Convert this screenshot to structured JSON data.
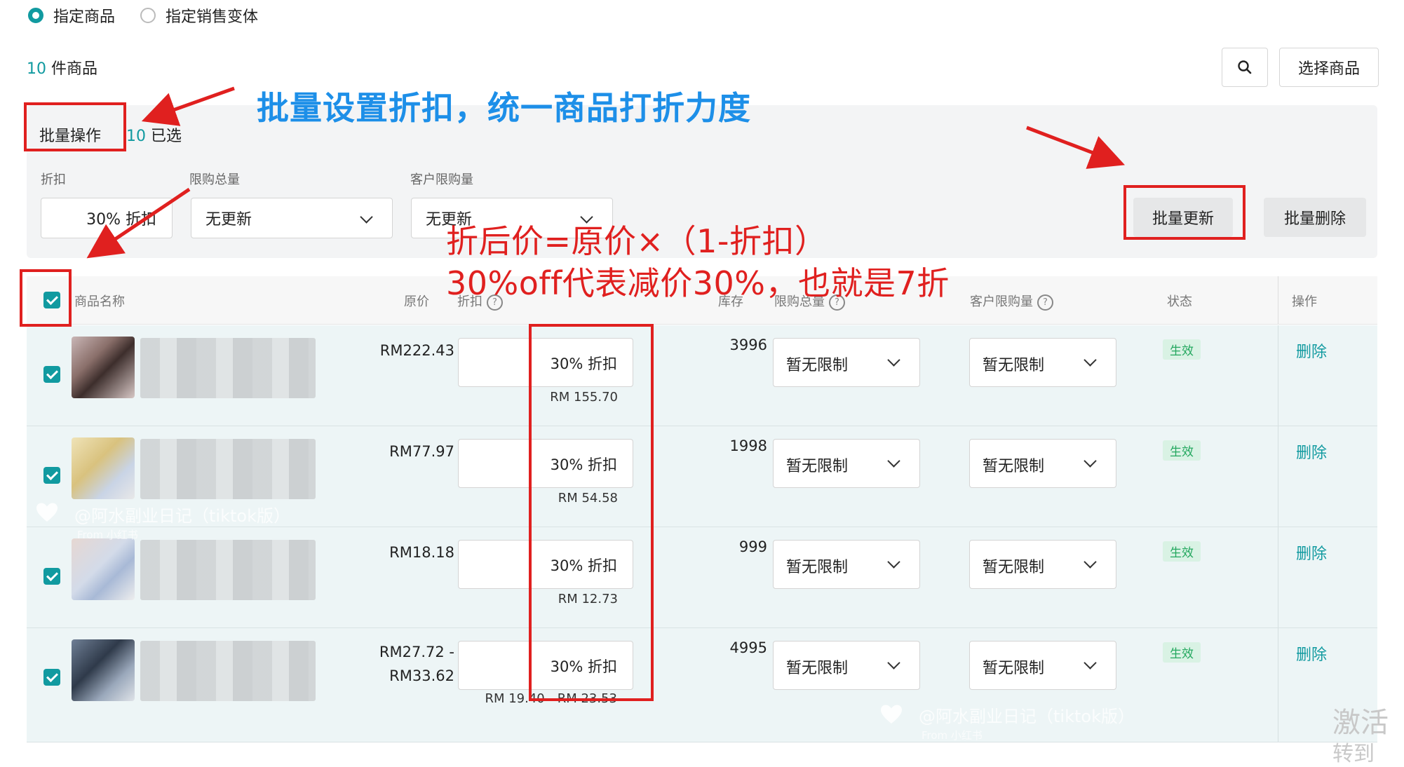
{
  "scope": {
    "option_specified_products": "指定商品",
    "option_specified_variants": "指定销售变体"
  },
  "product_count": {
    "num": "10",
    "label": "件商品"
  },
  "toolbar": {
    "search_icon": "search-icon",
    "select_products": "选择商品"
  },
  "batch": {
    "tab_label": "批量操作",
    "selected_num": "10",
    "selected_label": "已选",
    "discount_label": "折扣",
    "discount_value": "30% 折扣",
    "total_limit_label": "限购总量",
    "total_limit_value": "无更新",
    "customer_limit_label": "客户限购量",
    "customer_limit_value": "无更新",
    "update_button": "批量更新",
    "delete_button": "批量删除"
  },
  "annotations": {
    "batch_note": "批量设置折扣，统一商品打折力度",
    "formula": "折后价=原价×（1-折扣）",
    "explain": "30%off代表减价30%，也就是7折",
    "color_red": "#e0201f",
    "color_blue": "#1d8fe8"
  },
  "table": {
    "headers": {
      "name": "商品名称",
      "price": "原价",
      "discount": "折扣",
      "stock": "库存",
      "total_limit": "限购总量",
      "customer_limit": "客户限购量",
      "status": "状态",
      "action": "操作"
    },
    "rows": [
      {
        "price": "RM222.43",
        "discount": "30% 折扣",
        "after": "RM 155.70",
        "stock": "3996",
        "total_limit": "暂无限制",
        "customer_limit": "暂无限制",
        "status": "生效",
        "action": "删除"
      },
      {
        "price": "RM77.97",
        "discount": "30% 折扣",
        "after": "RM 54.58",
        "stock": "1998",
        "total_limit": "暂无限制",
        "customer_limit": "暂无限制",
        "status": "生效",
        "action": "删除"
      },
      {
        "price": "RM18.18",
        "discount": "30% 折扣",
        "after": "RM 12.73",
        "stock": "999",
        "total_limit": "暂无限制",
        "customer_limit": "暂无限制",
        "status": "生效",
        "action": "删除"
      },
      {
        "price_line1": "RM27.72 -",
        "price_line2": "RM33.62",
        "discount": "30% 折扣",
        "after": "RM 19.40 - RM 23.53",
        "stock": "4995",
        "total_limit": "暂无限制",
        "customer_limit": "暂无限制",
        "status": "生效",
        "action": "删除"
      }
    ]
  },
  "watermark": {
    "text": "@阿水副业日记（tiktok版）",
    "sub": "From 小红书"
  },
  "os_overlay": {
    "line1": "激活",
    "line2": "转到"
  },
  "accent": "#119aa0"
}
